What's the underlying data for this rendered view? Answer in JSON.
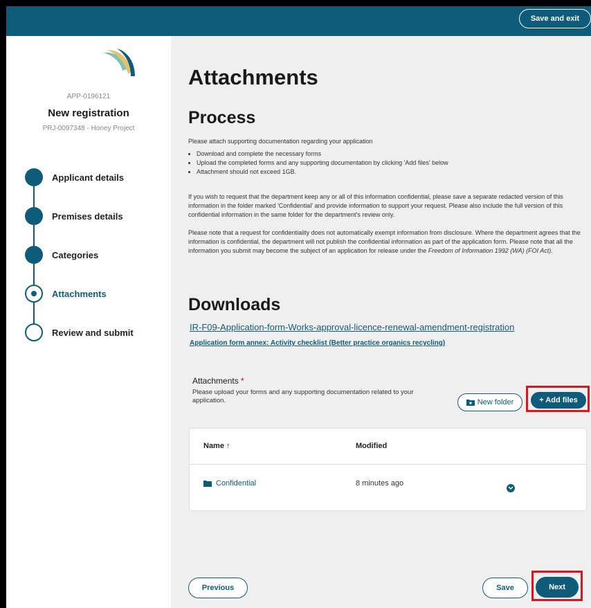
{
  "header": {
    "save_exit_label": "Save and exit"
  },
  "sidebar": {
    "app_id": "APP-0196121",
    "title": "New registration",
    "project": "PRJ-0097348 - Honey Project",
    "steps": [
      {
        "label": "Applicant details",
        "state": "complete"
      },
      {
        "label": "Premises details",
        "state": "complete"
      },
      {
        "label": "Categories",
        "state": "complete"
      },
      {
        "label": "Attachments",
        "state": "current"
      },
      {
        "label": "Review and submit",
        "state": "pending"
      }
    ]
  },
  "main": {
    "page_title": "Attachments",
    "process_heading": "Process",
    "intro": "Please attach supporting documentation regarding your application",
    "bullets": [
      "Download and complete the necessary forms",
      "Upload the completed forms and any supporting documentation by clicking 'Add files' below",
      "Attachment should not exceed 1GB."
    ],
    "confidential_para": "If you wish to request that the department keep any or all of this information confidential, please save a separate redacted version of this information in the folder marked 'Confidential' and provide information to support your request. Please also include the full version of this confidential information in the same folder for the department's review only.",
    "disclosure_para_1": "Please note that a request for confidentiality does not automatically exempt information from disclosure. Where the department agrees that the information is confidential, the department will not publish the confidential information as part of the application form. Please note that all the information you submit may become the subject of an application for release under the ",
    "disclosure_para_italic": "Freedom of Information 1992 (WA) (FOI Act).",
    "downloads_heading": "Downloads",
    "download_link_1": "IR-F09-Application-form-Works-approval-licence-renewal-amendment-registration",
    "download_link_2": "Application form annex: Activity checklist (Better practice organics recycling)",
    "attachments_label": "Attachments",
    "required_mark": "*",
    "attachments_help": "Please upload your forms and any supporting documentation related to your application.",
    "new_folder_label": "New folder",
    "add_files_label": "+ Add files",
    "table": {
      "col_name": "Name",
      "col_name_sort": "↑",
      "col_modified": "Modified",
      "rows": [
        {
          "name": "Confidential",
          "modified": "8 minutes ago"
        }
      ]
    },
    "previous_label": "Previous",
    "save_label": "Save",
    "next_label": "Next"
  },
  "colors": {
    "brand": "#0f5b7a",
    "highlight": "#e0121b",
    "main_bg": "#efefef"
  }
}
